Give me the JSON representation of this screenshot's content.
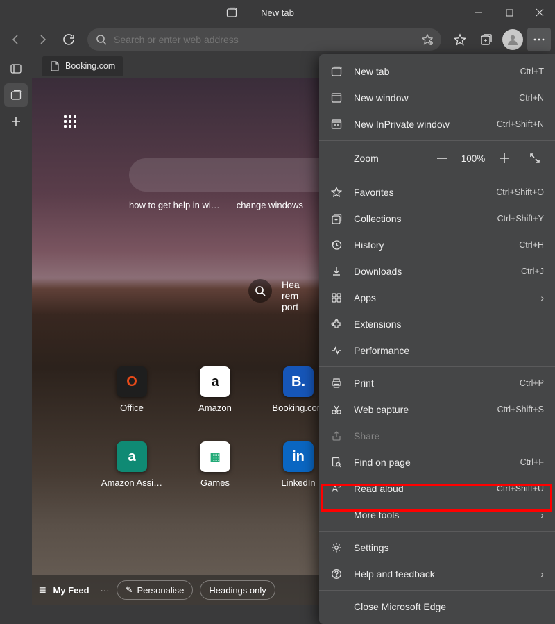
{
  "window": {
    "title": "New tab"
  },
  "addressbar": {
    "placeholder": "Search or enter web address"
  },
  "tab": {
    "label": "Booking.com"
  },
  "suggestions": [
    "how to get help in wi…",
    "change windows"
  ],
  "widget": {
    "lines": [
      "Hea",
      "rem",
      "port"
    ]
  },
  "apps": [
    {
      "name": "Office",
      "letter": "O",
      "bg": "#1e1e1e",
      "fg": "#e64a19"
    },
    {
      "name": "Amazon",
      "letter": "a",
      "bg": "#ffffff",
      "fg": "#111"
    },
    {
      "name": "Booking.com",
      "letter": "B.",
      "bg": "#1656b8",
      "fg": "#fff"
    },
    {
      "name": "Amazon Assi…",
      "letter": "a",
      "bg": "#0f8a74",
      "fg": "#fff"
    },
    {
      "name": "Games",
      "letter": "▦",
      "bg": "#ffffff",
      "fg": "#2a7"
    },
    {
      "name": "LinkedIn",
      "letter": "in",
      "bg": "#0a66c2",
      "fg": "#fff"
    }
  ],
  "feed": {
    "title": "My Feed",
    "personalise": "Personalise",
    "headings": "Headings only"
  },
  "menu": {
    "newtab": {
      "label": "New tab",
      "sc": "Ctrl+T"
    },
    "newwin": {
      "label": "New window",
      "sc": "Ctrl+N"
    },
    "inprivate": {
      "label": "New InPrivate window",
      "sc": "Ctrl+Shift+N"
    },
    "zoom": {
      "label": "Zoom",
      "value": "100%"
    },
    "favorites": {
      "label": "Favorites",
      "sc": "Ctrl+Shift+O"
    },
    "collections": {
      "label": "Collections",
      "sc": "Ctrl+Shift+Y"
    },
    "history": {
      "label": "History",
      "sc": "Ctrl+H"
    },
    "downloads": {
      "label": "Downloads",
      "sc": "Ctrl+J"
    },
    "apps": {
      "label": "Apps"
    },
    "extensions": {
      "label": "Extensions"
    },
    "performance": {
      "label": "Performance"
    },
    "print": {
      "label": "Print",
      "sc": "Ctrl+P"
    },
    "webcapture": {
      "label": "Web capture",
      "sc": "Ctrl+Shift+S"
    },
    "share": {
      "label": "Share"
    },
    "findonpage": {
      "label": "Find on page",
      "sc": "Ctrl+F"
    },
    "readaloud": {
      "label": "Read aloud",
      "sc": "Ctrl+Shift+U"
    },
    "moretools": {
      "label": "More tools"
    },
    "settings": {
      "label": "Settings"
    },
    "help": {
      "label": "Help and feedback"
    },
    "close": {
      "label": "Close Microsoft Edge"
    }
  }
}
